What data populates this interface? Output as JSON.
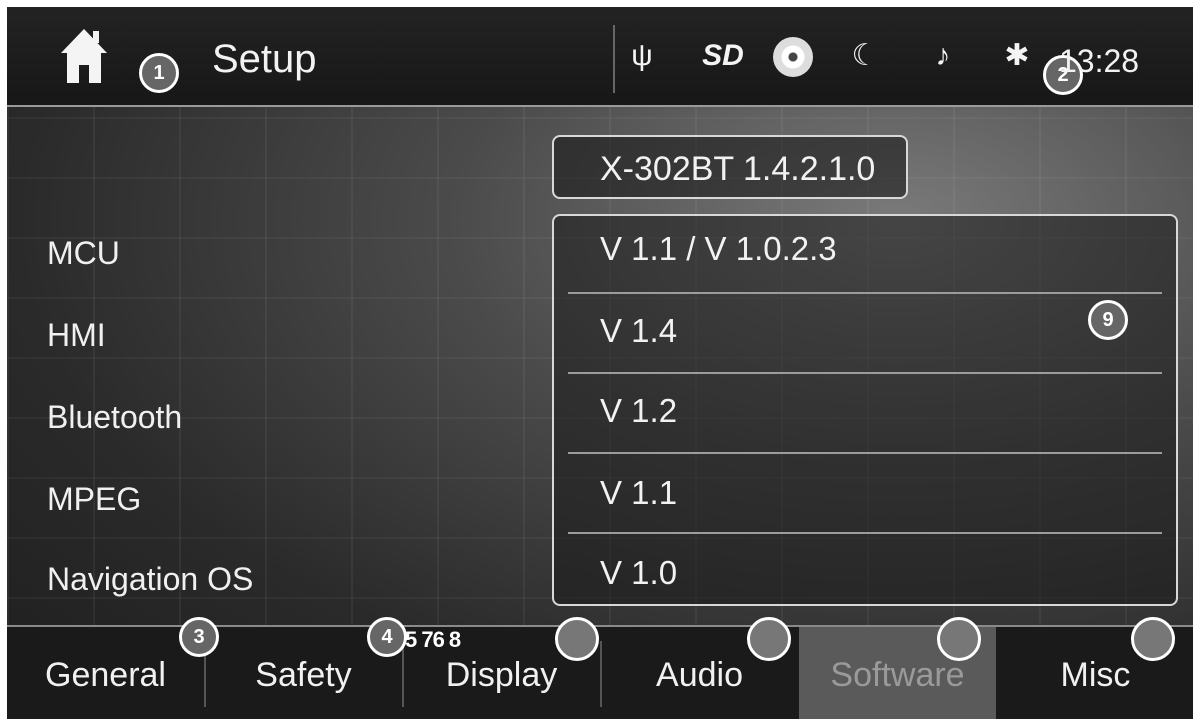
{
  "header": {
    "title": "Setup",
    "clock": "13:28",
    "icons": [
      "home-icon",
      "usb-icon",
      "sd-card-icon",
      "disc-icon",
      "night-mode-icon",
      "mute-icon",
      "bluetooth-icon"
    ],
    "sd_label": "SD"
  },
  "model": "X-302BT 1.4.2.1.0",
  "components": [
    {
      "label": "MCU",
      "version": "V 1.1 / V 1.0.2.3"
    },
    {
      "label": "HMI",
      "version": "V 1.4"
    },
    {
      "label": "Bluetooth",
      "version": "V 1.2"
    },
    {
      "label": "MPEG",
      "version": "V 1.1"
    },
    {
      "label": "Navigation OS",
      "version": "V 1.0"
    }
  ],
  "tabs": [
    {
      "label": "General"
    },
    {
      "label": "Safety"
    },
    {
      "label": "Display"
    },
    {
      "label": "Audio"
    },
    {
      "label": "Software",
      "active": true
    },
    {
      "label": "Misc"
    }
  ],
  "callouts": {
    "c1": "1",
    "c2": "2",
    "c3": "3",
    "c4": "4",
    "c9": "9",
    "c5678": "5 76 8"
  },
  "colors": {
    "background": "#2a2a2a",
    "active_tab": "#5a5a5a",
    "text": "#f2f2f2"
  }
}
